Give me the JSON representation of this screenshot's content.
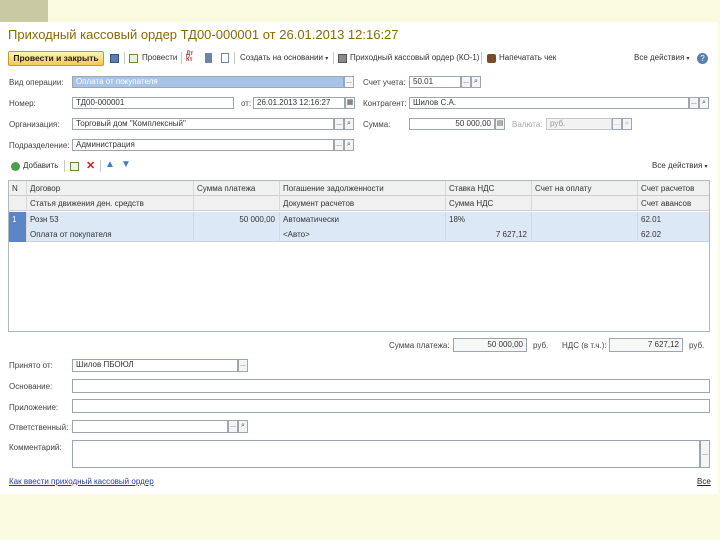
{
  "form": {
    "title": "Приходный кассовый ордер ТД00-000001 от 26.01.2013 12:16:27"
  },
  "toolbar": {
    "post_close": "Провести и закрыть",
    "post": "Провести",
    "create_based": "Создать на основании",
    "print_form": "Приходный кассовый ордер (КО-1)",
    "print_check": "Напечатать чек",
    "all_actions": "Все действия"
  },
  "header": {
    "op_type_label": "Вид операции:",
    "op_type": "Оплата от покупателя",
    "account_label": "Счет учета:",
    "account": "50.01",
    "number_label": "Номер:",
    "number": "ТД00-000001",
    "date_label": "от:",
    "date": "26.01.2013 12:16:27",
    "contractor_label": "Контрагент:",
    "contractor": "Шилов С.А.",
    "org_label": "Организация:",
    "org": "Торговый дом \"Комплексный\"",
    "sum_label": "Сумма:",
    "sum": "50 000,00",
    "currency_label": "Валюта:",
    "currency": "руб.",
    "dept_label": "Подразделение:",
    "dept": "Администрация"
  },
  "table_toolbar": {
    "add": "Добавить",
    "all_actions": "Все действия"
  },
  "table": {
    "headers_top": [
      "N",
      "Договор",
      "Сумма платежа",
      "Погашение задолженности",
      "Ставка НДС",
      "Счет на оплату",
      "Счет расчетов"
    ],
    "headers_bottom": [
      "Статья движения ден. средств",
      "Документ расчетов",
      "Сумма НДС",
      "Счет авансов"
    ],
    "row1": {
      "n": "1",
      "contract": "Розн 53",
      "sum": "50 000,00",
      "repay": "Автоматически",
      "vat_rate": "18%",
      "settle_acc": "62.01"
    },
    "row2": {
      "cashflow": "Оплата от покупателя",
      "doc": "<Авто>",
      "vat_sum": "7 627,12",
      "advance_acc": "62.02"
    }
  },
  "totals": {
    "pay_label": "Сумма платежа:",
    "pay": "50 000,00",
    "pay_unit": "руб.",
    "vat_label": "НДС (в т.ч.):",
    "vat": "7 627,12",
    "vat_unit": "руб."
  },
  "footer": {
    "received_label": "Принято от:",
    "received": "Шилов ПБОЮЛ",
    "basis_label": "Основание:",
    "attachment_label": "Приложение:",
    "responsible_label": "Ответственный:",
    "comment_label": "Комментарий:",
    "help_link": "Как ввести приходный кассовый ордер",
    "all_link": "Все"
  }
}
